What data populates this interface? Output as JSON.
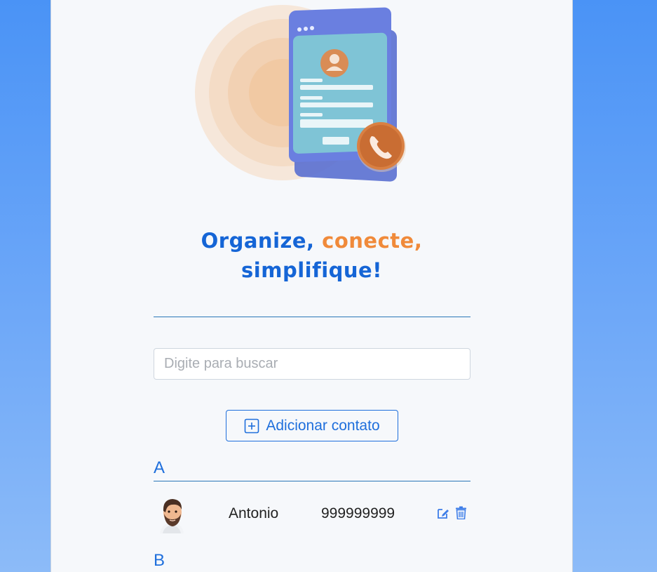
{
  "hero": {
    "illustration_icon": "contact-book-phone-icon"
  },
  "slogan": {
    "part1": "Organize, ",
    "part2": "conecte,",
    "part3": "simplifique!"
  },
  "search": {
    "placeholder": "Digite para buscar",
    "value": ""
  },
  "add_button": {
    "label": "Adicionar contato",
    "icon": "plus-square-icon"
  },
  "groups": [
    {
      "letter": "A",
      "contacts": [
        {
          "name": "Antonio",
          "phone": "999999999",
          "avatar_icon": "bearded-man-avatar"
        }
      ]
    },
    {
      "letter": "B",
      "contacts": []
    }
  ],
  "actions": {
    "edit_icon": "edit-icon",
    "delete_icon": "trash-icon"
  },
  "colors": {
    "primary": "#1565d6",
    "accent": "#f08a3a",
    "divider": "#2a77b8",
    "background_top": "#4a93f6"
  }
}
